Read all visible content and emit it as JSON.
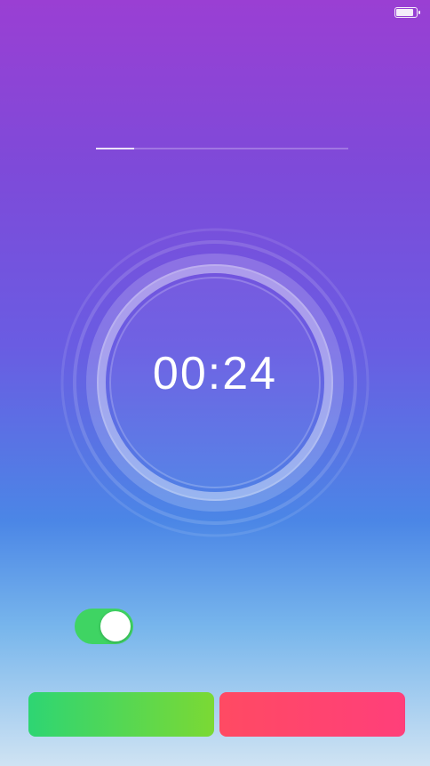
{
  "status_bar": {
    "carrier": "",
    "network": "",
    "time": "",
    "battery_percent": ""
  },
  "header": {
    "title": "",
    "subtitle": ""
  },
  "progress": {
    "left_label": "",
    "middle_label": "",
    "right_label": "",
    "fraction": 0.15
  },
  "timer": {
    "time": "00:24",
    "caption": ""
  },
  "toggle": {
    "on": true,
    "line1": "",
    "line2": ""
  },
  "buttons": {
    "pause_label": "",
    "complete_label": ""
  },
  "colors": {
    "accent_green": "#3fd463",
    "pause_green": "#2ed573",
    "complete_red": "#ff4a63"
  }
}
